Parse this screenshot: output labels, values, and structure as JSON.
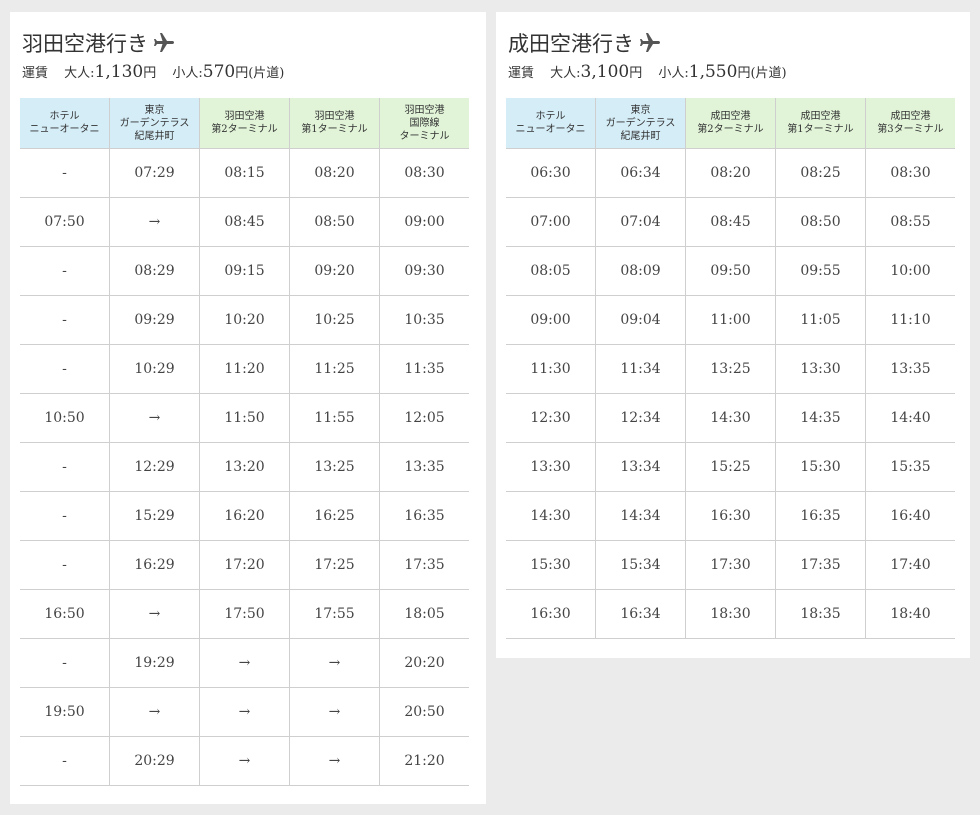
{
  "haneda": {
    "title": "羽田空港行き",
    "fare_label": "運賃",
    "adult_label": "大人:",
    "adult_price": "1,130",
    "child_label": "小人:",
    "child_price": "570",
    "yen": "円",
    "oneway": "(片道)",
    "headers": [
      "ホテル\nニューオータニ",
      "東京\nガーデンテラス\n紀尾井町",
      "羽田空港\n第2ターミナル",
      "羽田空港\n第1ターミナル",
      "羽田空港\n国際線\nターミナル"
    ],
    "rows": [
      [
        "-",
        "07:29",
        "08:15",
        "08:20",
        "08:30"
      ],
      [
        "07:50",
        "→",
        "08:45",
        "08:50",
        "09:00"
      ],
      [
        "-",
        "08:29",
        "09:15",
        "09:20",
        "09:30"
      ],
      [
        "-",
        "09:29",
        "10:20",
        "10:25",
        "10:35"
      ],
      [
        "-",
        "10:29",
        "11:20",
        "11:25",
        "11:35"
      ],
      [
        "10:50",
        "→",
        "11:50",
        "11:55",
        "12:05"
      ],
      [
        "-",
        "12:29",
        "13:20",
        "13:25",
        "13:35"
      ],
      [
        "-",
        "15:29",
        "16:20",
        "16:25",
        "16:35"
      ],
      [
        "-",
        "16:29",
        "17:20",
        "17:25",
        "17:35"
      ],
      [
        "16:50",
        "→",
        "17:50",
        "17:55",
        "18:05"
      ],
      [
        "-",
        "19:29",
        "→",
        "→",
        "20:20"
      ],
      [
        "19:50",
        "→",
        "→",
        "→",
        "20:50"
      ],
      [
        "-",
        "20:29",
        "→",
        "→",
        "21:20"
      ]
    ]
  },
  "narita": {
    "title": "成田空港行き",
    "fare_label": "運賃",
    "adult_label": "大人:",
    "adult_price": "3,100",
    "child_label": "小人:",
    "child_price": "1,550",
    "yen": "円",
    "oneway": "(片道)",
    "headers": [
      "ホテル\nニューオータニ",
      "東京\nガーデンテラス\n紀尾井町",
      "成田空港\n第2ターミナル",
      "成田空港\n第1ターミナル",
      "成田空港\n第3ターミナル"
    ],
    "rows": [
      [
        "06:30",
        "06:34",
        "08:20",
        "08:25",
        "08:30"
      ],
      [
        "07:00",
        "07:04",
        "08:45",
        "08:50",
        "08:55"
      ],
      [
        "08:05",
        "08:09",
        "09:50",
        "09:55",
        "10:00"
      ],
      [
        "09:00",
        "09:04",
        "11:00",
        "11:05",
        "11:10"
      ],
      [
        "11:30",
        "11:34",
        "13:25",
        "13:30",
        "13:35"
      ],
      [
        "12:30",
        "12:34",
        "14:30",
        "14:35",
        "14:40"
      ],
      [
        "13:30",
        "13:34",
        "15:25",
        "15:30",
        "15:35"
      ],
      [
        "14:30",
        "14:34",
        "16:30",
        "16:35",
        "16:40"
      ],
      [
        "15:30",
        "15:34",
        "17:30",
        "17:35",
        "17:40"
      ],
      [
        "16:30",
        "16:34",
        "18:30",
        "18:35",
        "18:40"
      ]
    ]
  },
  "icons": {
    "plane": "airplane-icon"
  },
  "colors": {
    "hotel_header": "#d5edf7",
    "airport_header": "#e1f4d8",
    "icon": "#555555"
  }
}
